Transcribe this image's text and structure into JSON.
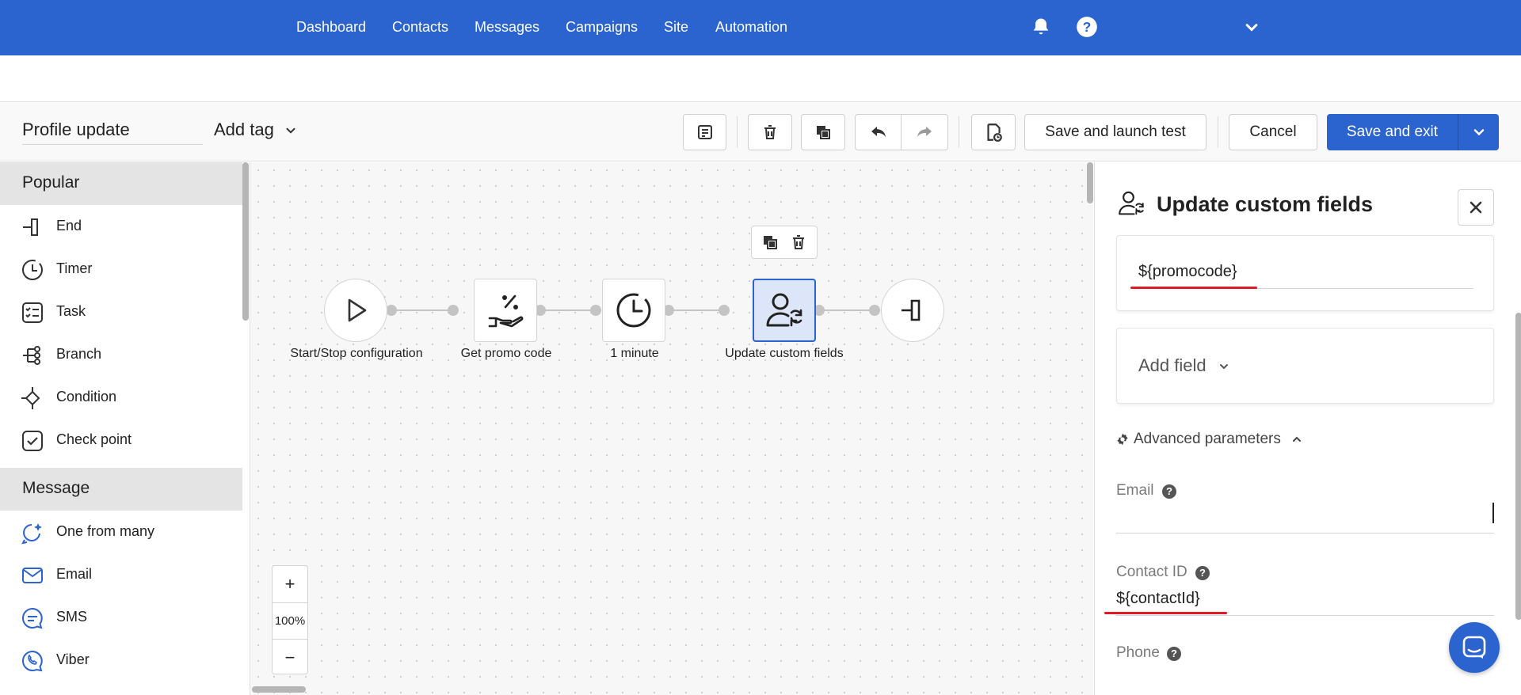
{
  "nav": {
    "links": [
      "Dashboard",
      "Contacts",
      "Messages",
      "Campaigns",
      "Site",
      "Automation"
    ],
    "icons": [
      "bell-icon",
      "help-icon",
      "chevron-down-icon"
    ]
  },
  "toolbar": {
    "flow_name": "Profile update",
    "add_tag": "Add tag",
    "icon_buttons": [
      "notes-icon",
      "trash-icon",
      "copy-icon",
      "undo-icon",
      "redo-icon",
      "test-history-icon"
    ],
    "save_test": "Save and launch test",
    "cancel": "Cancel",
    "save_exit": "Save and exit"
  },
  "sidebar": {
    "sections": [
      {
        "title": "Popular",
        "items": [
          {
            "label": "End",
            "icon": "end-icon"
          },
          {
            "label": "Timer",
            "icon": "timer-icon"
          },
          {
            "label": "Task",
            "icon": "task-icon"
          },
          {
            "label": "Branch",
            "icon": "branch-icon"
          },
          {
            "label": "Condition",
            "icon": "condition-icon"
          },
          {
            "label": "Check point",
            "icon": "check-point-icon"
          }
        ]
      },
      {
        "title": "Message",
        "items": [
          {
            "label": "One from many",
            "icon": "one-from-many-icon"
          },
          {
            "label": "Email",
            "icon": "email-icon"
          },
          {
            "label": "SMS",
            "icon": "sms-icon"
          },
          {
            "label": "Viber",
            "icon": "viber-icon"
          }
        ]
      }
    ]
  },
  "canvas": {
    "nodes": [
      {
        "label": "Start/Stop configuration",
        "icon": "play-icon"
      },
      {
        "label": "Get promo code",
        "icon": "promo-code-icon"
      },
      {
        "label": "1 minute",
        "icon": "timer-icon"
      },
      {
        "label": "Update custom fields",
        "icon": "user-sync-icon",
        "selected": true
      },
      {
        "label": "",
        "icon": "end-icon"
      }
    ],
    "zoom": {
      "plus": "+",
      "level": "100%",
      "minus": "−"
    }
  },
  "panel": {
    "title": "Update custom fields",
    "field_value": "${promocode}",
    "add_field": "Add field",
    "advanced": "Advanced parameters",
    "email_label": "Email",
    "email_value": "",
    "contact_id_label": "Contact ID",
    "contact_id_value": "${contactId}",
    "phone_label": "Phone"
  },
  "colors": {
    "primary": "#2b63cf",
    "highlight": "#e01a22",
    "selected_bg": "#dde6f8"
  }
}
